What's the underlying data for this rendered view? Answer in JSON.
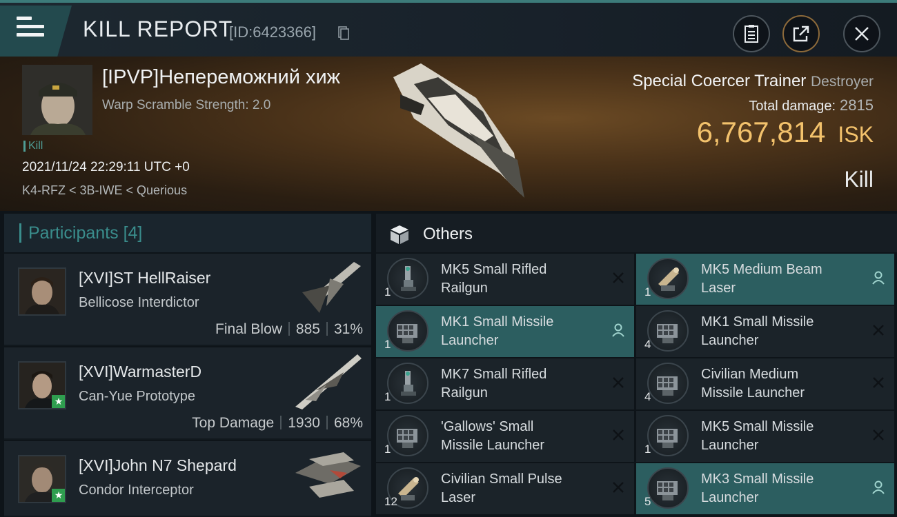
{
  "header": {
    "title": "KILL REPORT",
    "report_id": "[ID:6423366]"
  },
  "victim": {
    "name": "[IPVP]Непереможний хиж",
    "warp_scramble": "Warp Scramble Strength: 2.0",
    "tag": "Kill",
    "datetime": "2021/11/24 22:29:11 UTC +0",
    "location": "K4-RFZ < 3B-IWE < Querious",
    "ship_name": "Special Coercer Trainer",
    "ship_class": "Destroyer",
    "total_damage_label": "Total damage:",
    "total_damage": "2815",
    "isk_value": "6,767,814",
    "isk_unit": "ISK",
    "result": "Kill"
  },
  "participants": {
    "title": "Participants",
    "count": "[4]",
    "list": [
      {
        "name": "[XVI]ST HellRaiser",
        "ship": "Bellicose Interdictor",
        "role": "Final Blow",
        "damage": "885",
        "percent": "31%",
        "star": false
      },
      {
        "name": "[XVI]WarmasterD",
        "ship": "Can-Yue Prototype",
        "role": "Top Damage",
        "damage": "1930",
        "percent": "68%",
        "star": true
      },
      {
        "name": "[XVI]John N7 Shepard",
        "ship": "Condor Interceptor",
        "role": "",
        "damage": "",
        "percent": "",
        "star": true
      }
    ]
  },
  "others": {
    "title": "Others",
    "items": [
      {
        "line1": "MK5 Small Rifled",
        "line2": "Railgun",
        "qty": "1",
        "status": "destroyed",
        "icon": "railgun-icon"
      },
      {
        "line1": "MK5 Medium Beam",
        "line2": "Laser",
        "qty": "1",
        "status": "dropped",
        "icon": "laser-icon"
      },
      {
        "line1": "MK1 Small Missile",
        "line2": "Launcher",
        "qty": "1",
        "status": "dropped",
        "icon": "missile-launcher-icon"
      },
      {
        "line1": "MK1 Small Missile",
        "line2": "Launcher",
        "qty": "4",
        "status": "destroyed",
        "icon": "missile-launcher-icon"
      },
      {
        "line1": "MK7 Small Rifled",
        "line2": "Railgun",
        "qty": "1",
        "status": "destroyed",
        "icon": "railgun-icon"
      },
      {
        "line1": "Civilian Medium",
        "line2": "Missile Launcher",
        "qty": "4",
        "status": "destroyed",
        "icon": "missile-launcher-icon"
      },
      {
        "line1": "'Gallows' Small",
        "line2": "Missile Launcher",
        "qty": "1",
        "status": "destroyed",
        "icon": "missile-launcher-icon"
      },
      {
        "line1": "MK5 Small Missile",
        "line2": "Launcher",
        "qty": "1",
        "status": "destroyed",
        "icon": "missile-launcher-icon"
      },
      {
        "line1": "Civilian Small Pulse",
        "line2": "Laser",
        "qty": "12",
        "status": "destroyed",
        "icon": "laser-icon"
      },
      {
        "line1": "MK3 Small Missile",
        "line2": "Launcher",
        "qty": "5",
        "status": "dropped",
        "icon": "missile-launcher-icon"
      }
    ]
  },
  "colors": {
    "accent_teal": "#3a8d8c",
    "isk_gold": "#f3c26c",
    "active_row": "#2c5e60"
  }
}
